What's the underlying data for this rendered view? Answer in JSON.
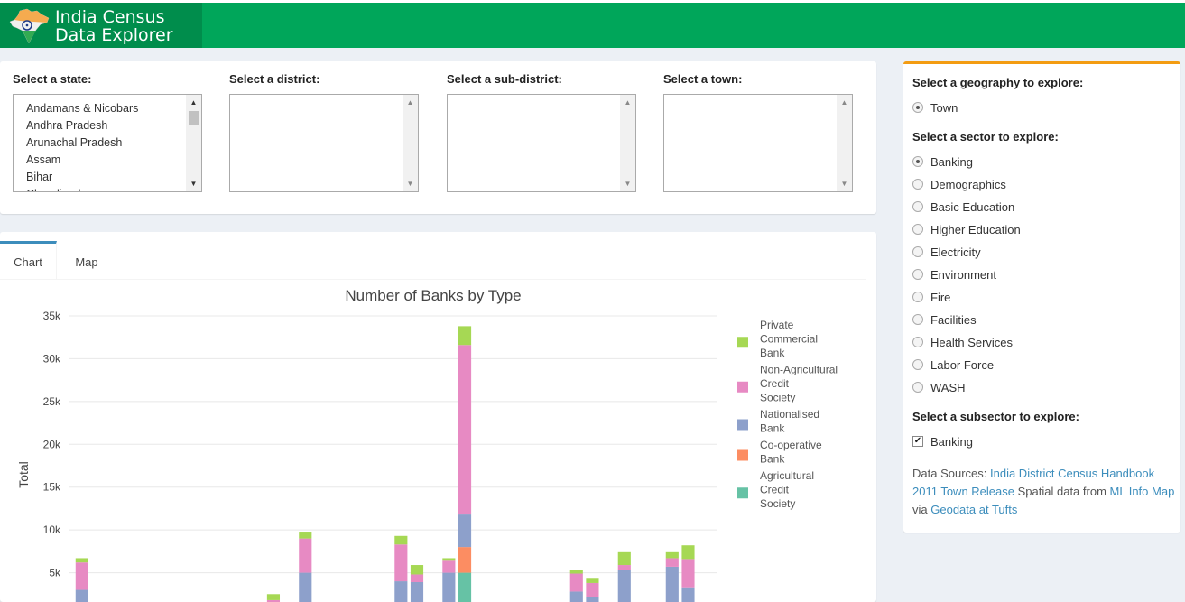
{
  "header": {
    "title_line1": "India Census",
    "title_line2": "Data Explorer"
  },
  "selectors": {
    "state": {
      "label": "Select a state:",
      "options": [
        "Andamans & Nicobars",
        "Andhra Pradesh",
        "Arunachal Pradesh",
        "Assam",
        "Bihar",
        "Chandigarh"
      ]
    },
    "district": {
      "label": "Select a district:"
    },
    "subdistrict": {
      "label": "Select a sub-district:"
    },
    "town": {
      "label": "Select a town:"
    }
  },
  "tabs": {
    "chart": "Chart",
    "map": "Map"
  },
  "sidebar": {
    "geography_label": "Select a geography to explore:",
    "geography_options": [
      {
        "label": "Town",
        "checked": true
      }
    ],
    "sector_label": "Select a sector to explore:",
    "sector_options": [
      {
        "label": "Banking",
        "checked": true
      },
      {
        "label": "Demographics",
        "checked": false
      },
      {
        "label": "Basic Education",
        "checked": false
      },
      {
        "label": "Higher Education",
        "checked": false
      },
      {
        "label": "Electricity",
        "checked": false
      },
      {
        "label": "Environment",
        "checked": false
      },
      {
        "label": "Fire",
        "checked": false
      },
      {
        "label": "Facilities",
        "checked": false
      },
      {
        "label": "Health Services",
        "checked": false
      },
      {
        "label": "Labor Force",
        "checked": false
      },
      {
        "label": "WASH",
        "checked": false
      }
    ],
    "subsector_label": "Select a subsector to explore:",
    "subsector_options": [
      {
        "label": "Banking",
        "checked": true
      }
    ],
    "sources": {
      "prefix": "Data Sources:",
      "link1": "India District Census Handbook 2011 Town Release",
      "middle": "Spatial data from",
      "link2": "ML Info Map",
      "via": "via",
      "link3": "Geodata at Tufts"
    }
  },
  "chart_data": {
    "type": "bar",
    "stacked": true,
    "title": "Number of Banks by Type",
    "ylabel": "Total",
    "ylim": [
      0,
      35000
    ],
    "yticks": [
      "5k",
      "10k",
      "15k",
      "20k",
      "25k",
      "30k",
      "35k"
    ],
    "ytick_values": [
      5000,
      10000,
      15000,
      20000,
      25000,
      30000,
      35000
    ],
    "legend_position": "right",
    "series": [
      {
        "name": "Agricultural Credit Society",
        "legend_lines": [
          "Agricultural",
          "Credit",
          "Society"
        ],
        "color": "#66c2a5",
        "values": [
          0,
          0,
          0,
          0,
          0,
          0,
          0,
          0,
          0,
          0,
          0,
          0,
          0,
          0,
          0,
          0,
          0,
          0,
          0,
          0,
          0,
          0,
          0,
          0,
          5000,
          0,
          0,
          0,
          0,
          0,
          0,
          0,
          0,
          0,
          0,
          0,
          0,
          0,
          0,
          0
        ]
      },
      {
        "name": "Co-operative Bank",
        "legend_lines": [
          "Co-operative",
          "Bank"
        ],
        "color": "#fc8d62",
        "values": [
          0,
          0,
          0,
          0,
          0,
          0,
          0,
          0,
          0,
          0,
          0,
          0,
          0,
          0,
          0,
          0,
          0,
          0,
          0,
          0,
          0,
          0,
          0,
          200,
          3000,
          0,
          0,
          0,
          0,
          0,
          0,
          0,
          0,
          0,
          0,
          0,
          0,
          200,
          300,
          0
        ]
      },
      {
        "name": "Nationalised Bank",
        "legend_lines": [
          "Nationalised",
          "Bank"
        ],
        "color": "#8da0cb",
        "values": [
          3000,
          0,
          0,
          0,
          0,
          0,
          0,
          0,
          0,
          0,
          0,
          0,
          0,
          0,
          5000,
          0,
          0,
          0,
          0,
          0,
          4000,
          3900,
          0,
          4800,
          3800,
          0,
          0,
          0,
          0,
          0,
          0,
          2800,
          2200,
          0,
          5300,
          0,
          0,
          5500,
          3000,
          0
        ]
      },
      {
        "name": "Non-Agricultural Credit Society",
        "legend_lines": [
          "Non-Agricultural",
          "Credit",
          "Society"
        ],
        "color": "#e78ac3",
        "values": [
          3200,
          0,
          0,
          0,
          0,
          0,
          0,
          0,
          0,
          0,
          0,
          0,
          1800,
          0,
          4000,
          0,
          0,
          0,
          0,
          0,
          4300,
          900,
          0,
          1400,
          19800,
          0,
          0,
          0,
          0,
          0,
          0,
          2100,
          1600,
          0,
          600,
          0,
          0,
          1000,
          3300,
          0
        ]
      },
      {
        "name": "Private Commercial Bank",
        "legend_lines": [
          "Private",
          "Commercial",
          "Bank"
        ],
        "color": "#a6d854",
        "values": [
          500,
          0,
          0,
          0,
          0,
          0,
          0,
          0,
          0,
          0,
          0,
          0,
          700,
          0,
          800,
          300,
          0,
          0,
          0,
          0,
          1000,
          1100,
          0,
          300,
          2200,
          0,
          0,
          0,
          0,
          0,
          0,
          400,
          600,
          0,
          1500,
          0,
          0,
          700,
          1600,
          0
        ]
      }
    ]
  }
}
